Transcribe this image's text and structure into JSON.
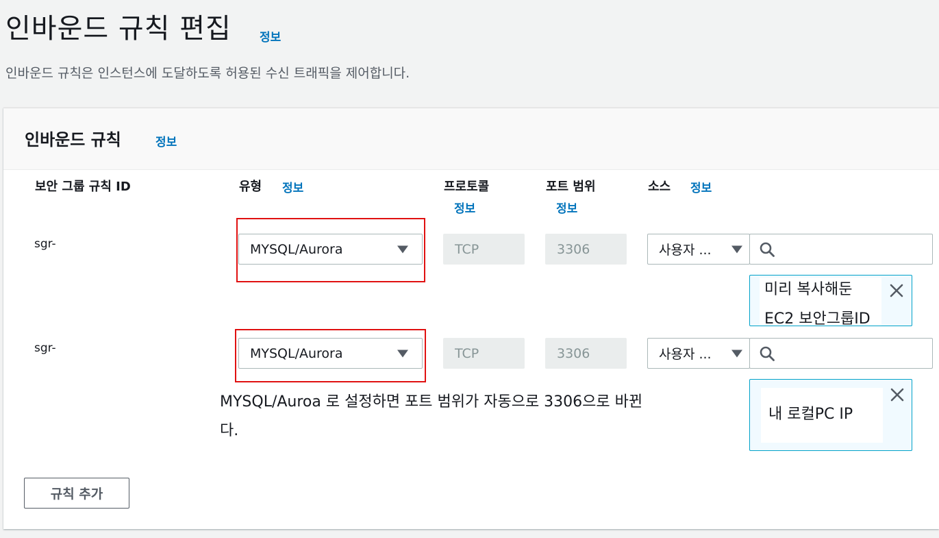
{
  "page": {
    "title": "인바운드 규칙 편집",
    "info_label": "정보",
    "description": "인바운드 규칙은 인스턴스에 도달하도록 허용된 수신 트래픽을 제어합니다."
  },
  "panel": {
    "title": "인바운드 규칙",
    "info_label": "정보",
    "columns": {
      "rule_id": "보안 그룹 규칙 ID",
      "type": "유형",
      "protocol": "프로토콜",
      "port_range": "포트 범위",
      "source": "소스",
      "info_label": "정보"
    },
    "rules": [
      {
        "id": "sgr-",
        "type": "MYSQL/Aurora",
        "protocol": "TCP",
        "port": "3306",
        "source_type": "사용자 ...",
        "search_value": "",
        "token_lines": [
          "미리 복사해둔",
          "EC2 보안그룹ID"
        ]
      },
      {
        "id": "sgr-",
        "type": "MYSQL/Aurora",
        "protocol": "TCP",
        "port": "3306",
        "source_type": "사용자 ...",
        "search_value": "",
        "token_lines": [
          "내 로컬PC IP"
        ]
      }
    ],
    "annotation": [
      "MYSQL/Auroa 로 설정하면 포트 범위가 자동으로 3306으로 바뀐",
      "다."
    ],
    "add_rule_label": "규칙 추가"
  },
  "colors": {
    "link": "#0073bb",
    "highlight_border": "#e01010",
    "token_border": "#00a1c9"
  },
  "icons": {
    "search": "search-icon",
    "close": "close-icon",
    "dropdown": "caret-down-icon"
  }
}
